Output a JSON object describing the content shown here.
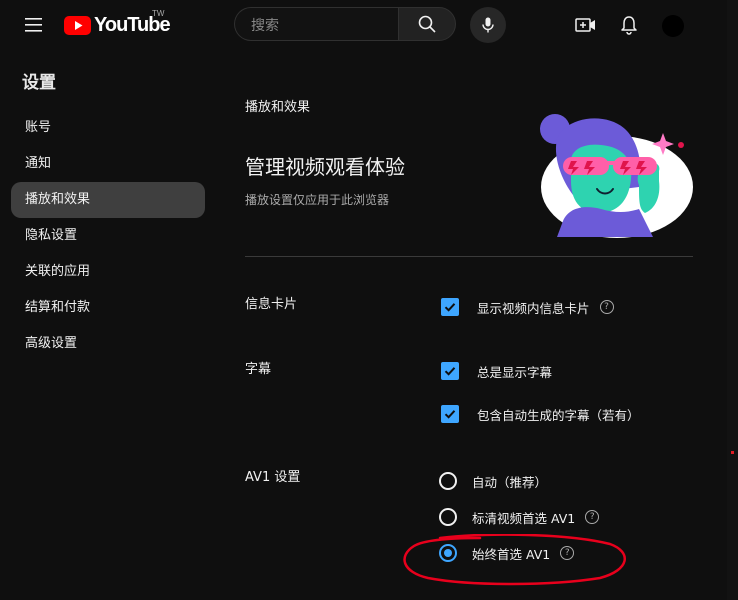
{
  "header": {
    "logo_text": "YouTube",
    "region": "TW",
    "search_placeholder": "搜索"
  },
  "sidebar": {
    "title": "设置",
    "items": [
      {
        "label": "账号"
      },
      {
        "label": "通知"
      },
      {
        "label": "播放和效果",
        "active": true
      },
      {
        "label": "隐私设置"
      },
      {
        "label": "关联的应用"
      },
      {
        "label": "结算和付款"
      },
      {
        "label": "高级设置"
      }
    ]
  },
  "main": {
    "section_name": "播放和效果",
    "heading": "管理视频观看体验",
    "subheading": "播放设置仅应用于此浏览器",
    "info_cards": {
      "label": "信息卡片",
      "option": "显示视频内信息卡片",
      "checked": true
    },
    "captions": {
      "label": "字幕",
      "options": [
        {
          "label": "总是显示字幕",
          "checked": true
        },
        {
          "label": "包含自动生成的字幕（若有）",
          "checked": true
        }
      ]
    },
    "av1": {
      "label": "AV1 设置",
      "options": [
        {
          "label": "自动（推荐）",
          "selected": false
        },
        {
          "label": "标清视频首选 AV1",
          "selected": false
        },
        {
          "label": "始终首选 AV1",
          "selected": true
        }
      ]
    },
    "help_glyph": "?"
  },
  "colors": {
    "accent": "#3ea6ff",
    "background": "#0f0f0f",
    "youtube_red": "#ff0000",
    "annotation": "#e8001c"
  }
}
